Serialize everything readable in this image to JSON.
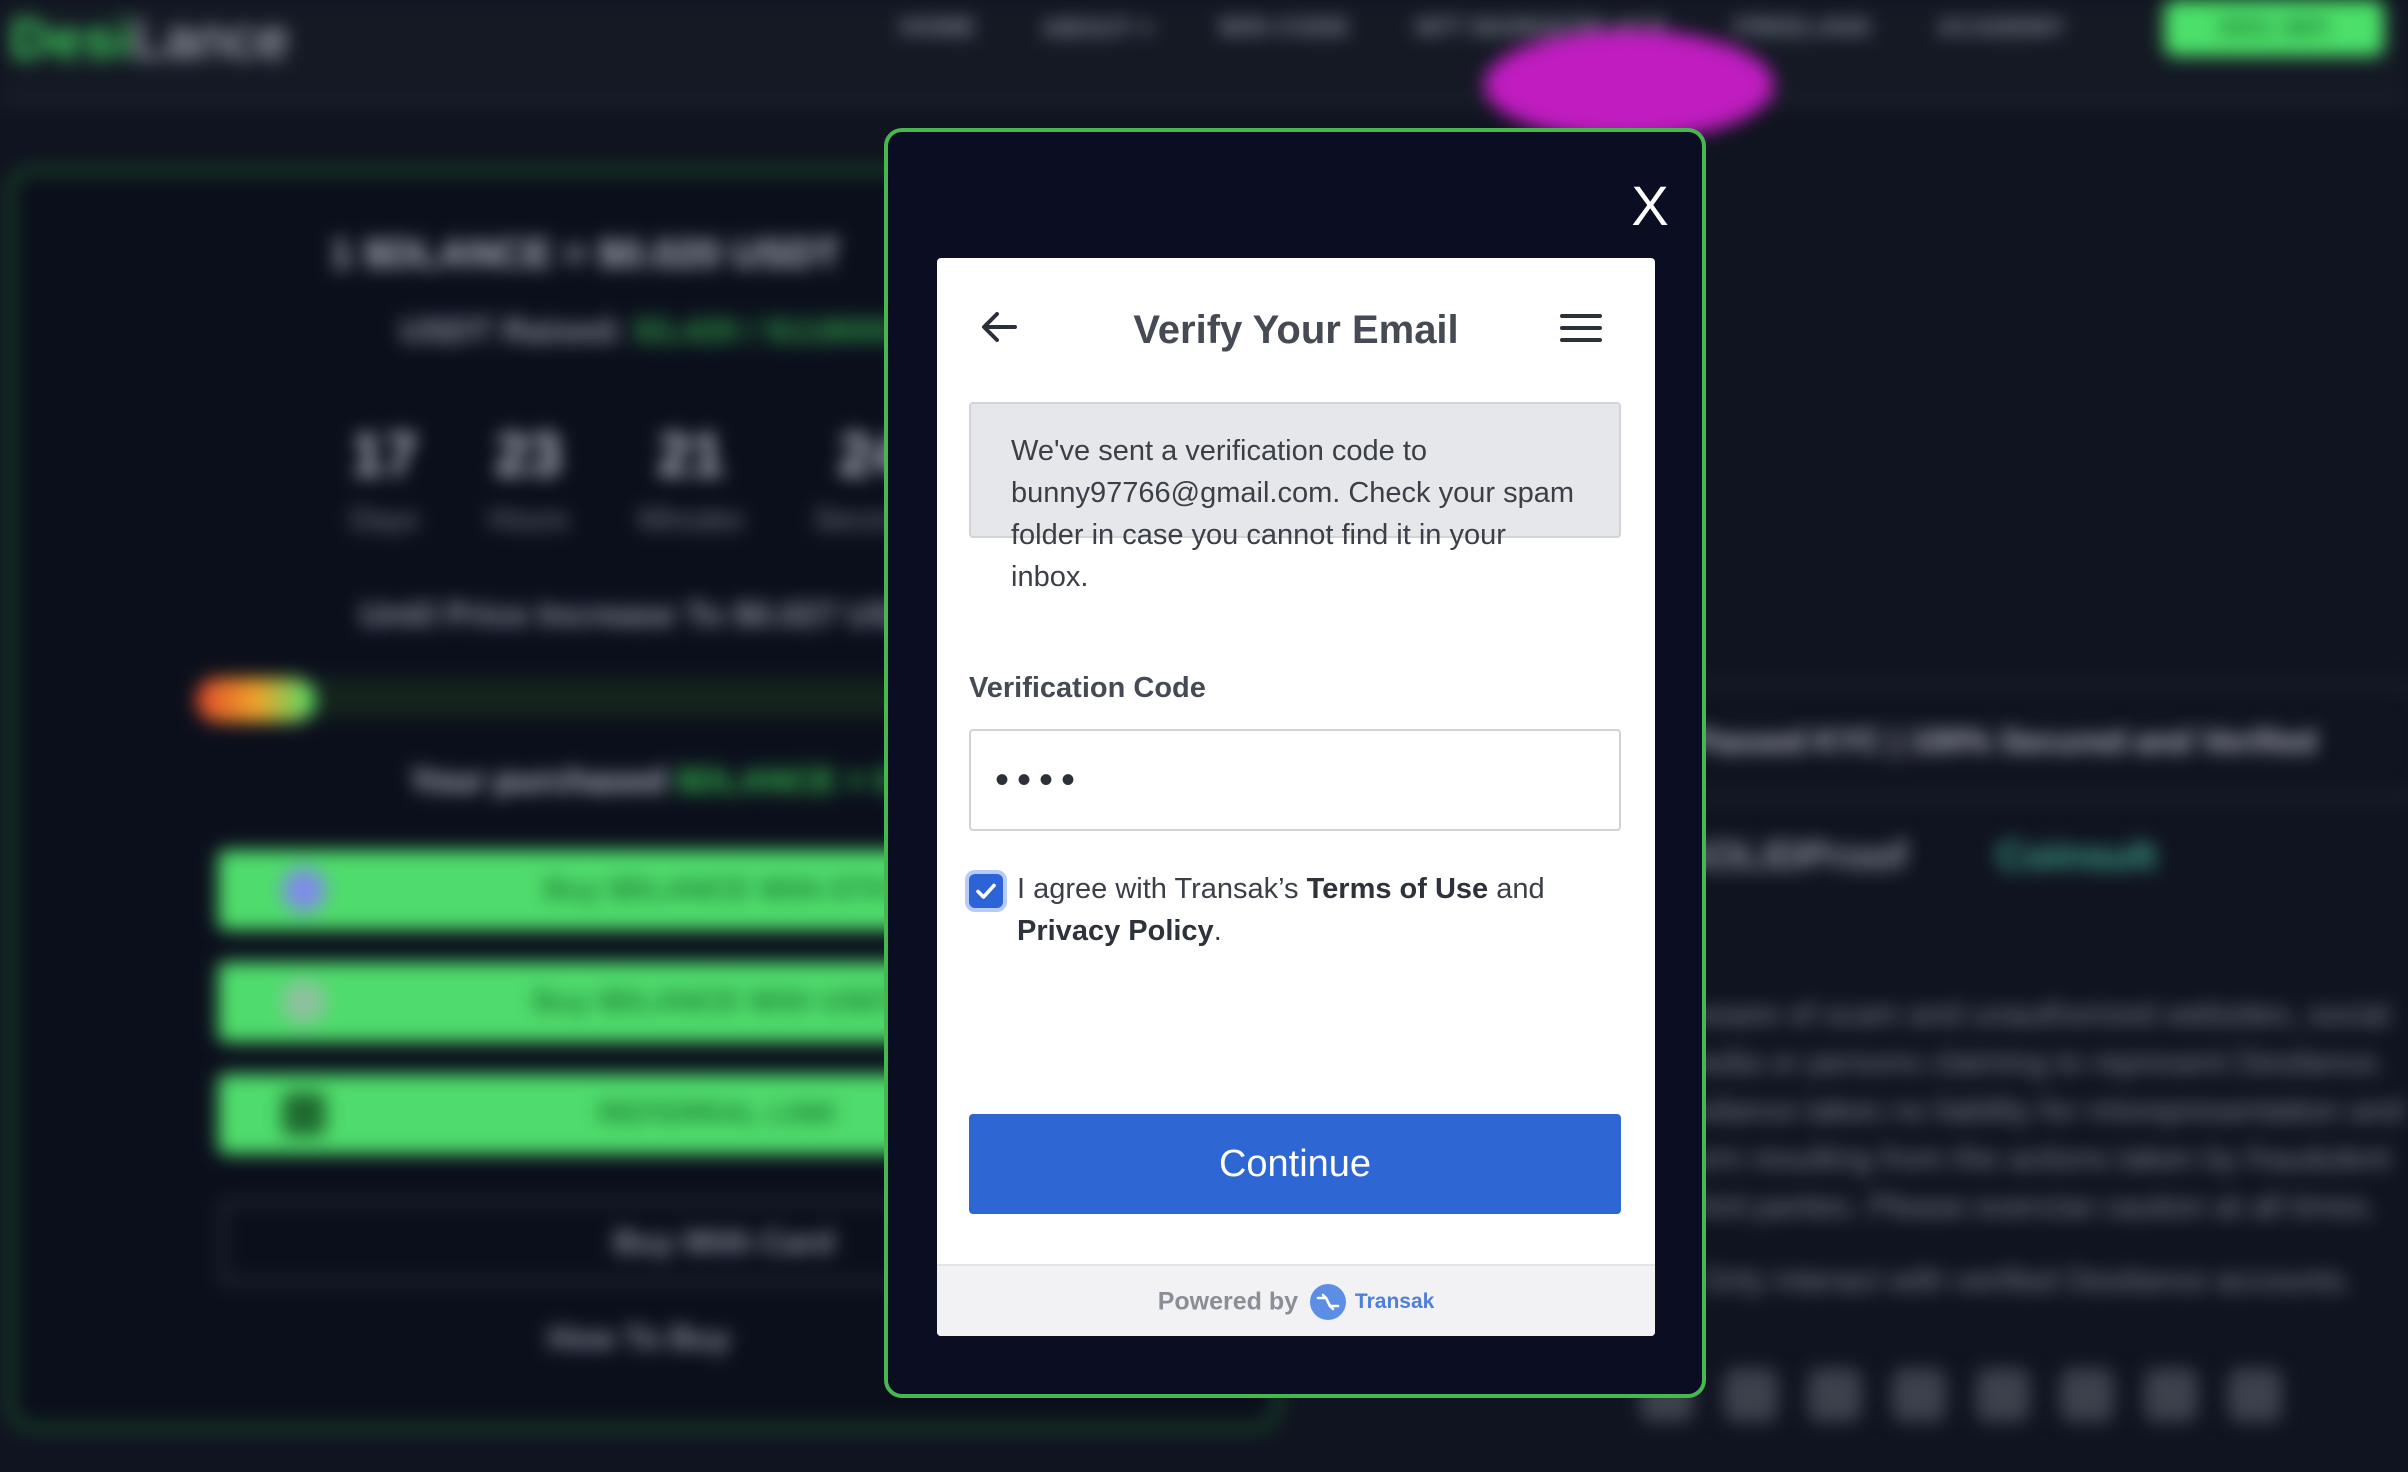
{
  "background": {
    "logo": {
      "part1": "Desi",
      "part2": "Lance"
    },
    "nav": [
      "HOME",
      "ABOUT ▾",
      "WIN CODE",
      "NFT MARKETPLACE",
      "FREELANS",
      "ACADEMY"
    ],
    "nav_button": "DESI_WIFI",
    "balance": {
      "prefix": "1 $DLANCE = ",
      "value": "$0.020 USDT"
    },
    "raised": {
      "label": "USDT Raised: ",
      "value": "$3,420 / $118000"
    },
    "timer": [
      {
        "value": "17",
        "label": "Days"
      },
      {
        "value": "23",
        "label": "Hours"
      },
      {
        "value": "21",
        "label": "Minutes"
      },
      {
        "value": "24",
        "label": "Seconds"
      }
    ],
    "until_text": "Until Price Increase To $0.027 USDT",
    "purchased": {
      "label": "Your purchased ",
      "value": "$DLANCE = 0"
    },
    "buttons": [
      "Buy $DLANCE With ETH",
      "Buy $DLANCE With USDT",
      "REFERRAL LINK"
    ],
    "card_button": "Buy With Card",
    "howto": "How To Buy",
    "kyc": "Passed KYC | 100% Secured and Verified",
    "partners": [
      "SOLIDProof",
      "Coinsult"
    ],
    "paragraph": "Beware of scam and unauthorized websites, social media or persons claiming to represent Desilance. Desilance takes no liability for misrepresentation and harm resulting from the actions taken by fraudulent third parties. Please exercise caution at all times.",
    "note": "Only interact with verified Desilance accounts."
  },
  "modal": {
    "close_label": "X",
    "title": "Verify Your Email",
    "notice": "We've sent a verification code to bunny97766@gmail.com. Check your spam folder in case you cannot find it in your inbox.",
    "field_label": "Verification Code",
    "code_value": "••••",
    "agree": {
      "prefix": "I agree with Transak’s ",
      "terms": "Terms of Use",
      "and": " and",
      "privacy": "Privacy Policy",
      "suffix": "."
    },
    "checked": true,
    "continue_label": "Continue",
    "footer": {
      "powered": "Powered by",
      "brand": "Transak"
    },
    "colors": {
      "accent": "#2e66d4",
      "border": "#47b84f",
      "modal_bg": "#0b0e23"
    }
  }
}
